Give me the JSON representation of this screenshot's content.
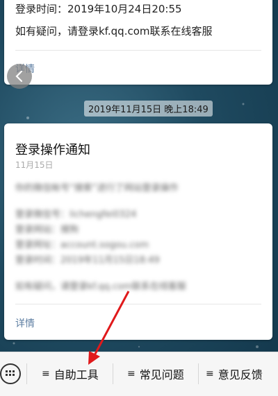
{
  "card1": {
    "login_time": "登录时间：2019年10月24日20:55",
    "help_text": "如有疑问，请登录kf.qq.com联系在线客服",
    "detail_label": "详情"
  },
  "timestamp": "2019年11月15日 晚上18:49",
  "card2": {
    "title": "登录操作通知",
    "date": "11月15日",
    "blurred_lines": [
      "你的微信帐号“搜索”进行了网站登录操作",
      "登录微信号：lichengfei0324",
      "登录网站：搜狗",
      "登录网址：account.sogou.com",
      "登录时间：2019年11月15日18:49",
      "如有疑问，请登录kf.qq.com联系在线客服"
    ],
    "detail_label": "详情"
  },
  "bottom_menu": {
    "items": [
      {
        "label": "自助工具",
        "icon": "menu-lines-icon"
      },
      {
        "label": "常见问题",
        "icon": "menu-lines-icon"
      },
      {
        "label": "意见反馈",
        "icon": "menu-lines-icon"
      }
    ]
  },
  "colors": {
    "link": "#5d7ea2",
    "arrow": "#e0191b"
  }
}
